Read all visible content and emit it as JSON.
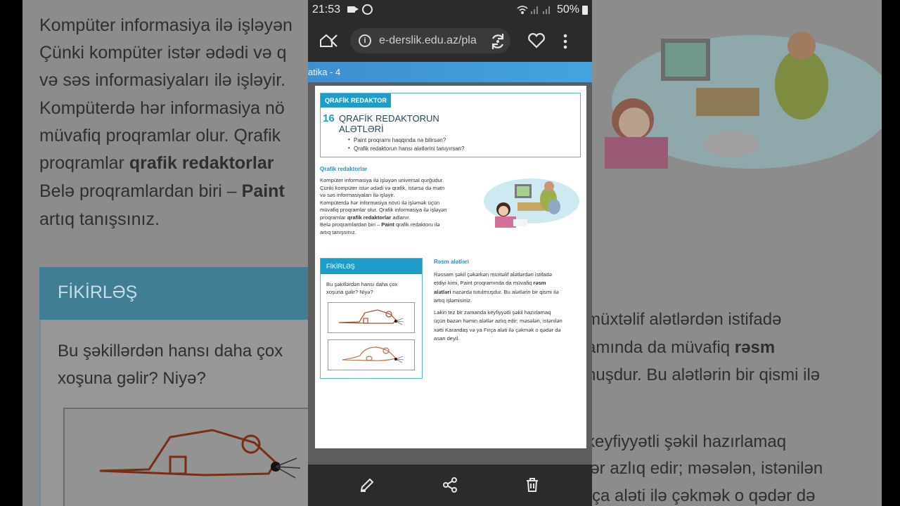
{
  "status_bar": {
    "time": "21:53",
    "battery": "50%",
    "icons": [
      "video-icon",
      "whatsapp-icon",
      "wifi-icon",
      "signal-icon",
      "signal-icon",
      "battery-icon"
    ]
  },
  "browser": {
    "url": "e-derslik.edu.az/pla",
    "icons": [
      "home-icon",
      "back-icon",
      "info-icon",
      "reload-icon",
      "heart-icon",
      "menu-icon"
    ]
  },
  "page_header": "atika - 4",
  "lesson": {
    "tag": "QRAFİK REDAKTOR",
    "number": "16",
    "title_line1": "QRAFİK REDAKTORUN",
    "title_line2": "ALƏTLƏRİ",
    "questions": [
      "Paint proqramı haqqında nə bilirsən?",
      "Qrafik redaktorun hansı alətlərini tanıyırsan?"
    ]
  },
  "section1": {
    "heading": "Qrafik redaktorlar",
    "lines": [
      "Kompüter informasiya ilə işləyən universal qurğudur.",
      "Çünki kompüter istər ədədi və qrafik, istərsə də mətn",
      "və səs informasiyaları ilə işləyir.",
      "Kompüterdə hər informasiya növü ilə işləmək üçün",
      "müvafiq proqramlar olur. Qrafik informasiya ilə işləyən"
    ],
    "line6_pre": "proqramlar ",
    "line6_bold": "qrafik redaktorlar",
    "line6_post": " adlanır.",
    "line7_pre": "Belə proqramlardan biri – ",
    "line7_bold": "Paint",
    "line7_post": " qrafik redaktoru ilə",
    "line8": "artıq tanışsınız."
  },
  "fikirles": {
    "heading": "FİKİRLƏŞ",
    "question_line1": "Bu şəkillərdən hansı daha çox",
    "question_line2": "xoşuna gəlir? Niyə?"
  },
  "section2": {
    "heading": "Rəsm alətləri",
    "p1_line1": "Rəssam şəkil çəkərkən müxtəlif alətlərdən istifadə",
    "p1_line2_pre": "etdiyi kimi, Paint proqramında da müvafiq ",
    "p1_line2_bold": "rəsm",
    "p1_line3_bold": "alətləri",
    "p1_line3_post": " nəzərdə tutulmuşdur. Bu alətlərin bir qismi ilə",
    "p1_line4": "artıq işləmisiniz.",
    "p2_lines": [
      "Lakin tez bir zamanda keyfiyyətli şəkil hazırlamaq",
      "üçün bəzən həmin alətlər azlıq edir; məsələn, istənilən",
      "xətti Karandaş və ya Fırça aləti ilə çəkmək o qədər də",
      "asan deyil."
    ]
  },
  "background_left": {
    "lines": [
      "Kompüter informasiya ilə işləyən",
      "Çünki kompüter istər ədədi və q",
      "və səs informasiyaları ilə işləyir.",
      "Kompüterdə hər informasiya nö",
      "müvafiq proqramlar olur. Qrafik",
      "artıq tanışsınız."
    ],
    "line6_pre": "proqramlar ",
    "line6_bold": "qrafik redaktorlar",
    "line7_pre": "Belə proqramlardan biri – ",
    "line7_bold": "Paint",
    "fik_heading": "FİKİRLƏŞ",
    "q_line1": "Bu şəkillərdən hansı daha çox",
    "q_line2": "xoşuna gəlir? Niyə?"
  },
  "background_right": {
    "line1": "müxtəlif alətlərdən istifadə",
    "line2_pre": "amında da müvafiq ",
    "line2_bold": "rəsm",
    "line3": "nuşdur. Bu alətlərin bir qismi ilə",
    "line4": "keyfiyyətli şəkil hazırlamaq",
    "line5": "lər azlıq edir; məsələn, istənilən",
    "line6": "rça aləti ilə çəkmək o qədər də"
  },
  "bottom_bar": {
    "icons": [
      "edit-icon",
      "share-icon",
      "delete-icon"
    ]
  }
}
